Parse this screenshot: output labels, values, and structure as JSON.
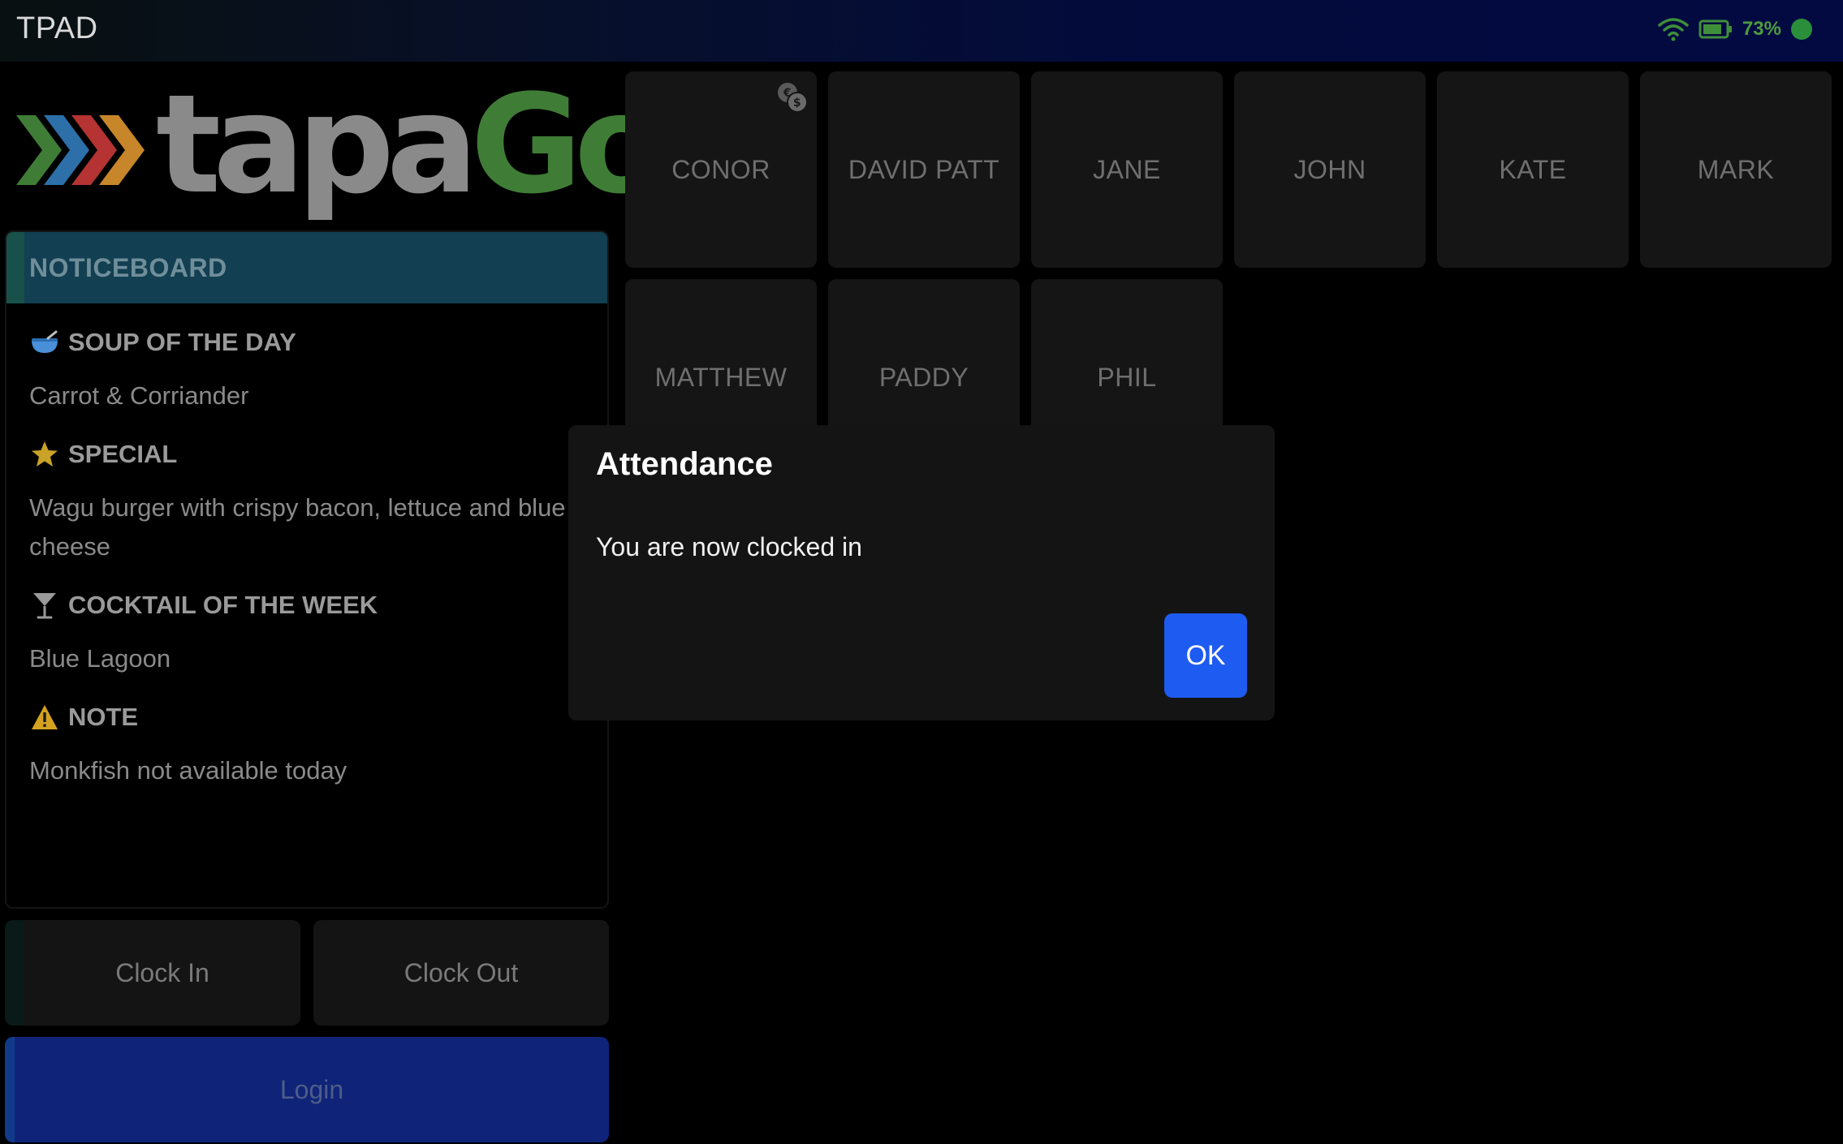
{
  "status_bar": {
    "device_name": "TPAD",
    "battery_percent": "73%",
    "icons": [
      "wifi-icon",
      "battery-icon",
      "status-dot"
    ]
  },
  "logo": {
    "text_part1": "tapa",
    "text_part2": "Go",
    "colors": {
      "tapa": "#8a8a8a",
      "go": "#3f7d36",
      "chevrons": [
        "#3f7d36",
        "#2d6fa8",
        "#b53333",
        "#c7862a"
      ]
    }
  },
  "noticeboard": {
    "header": "NOTICEBOARD",
    "items": [
      {
        "icon": "soup-bowl-icon",
        "title": "SOUP OF THE DAY",
        "text": "Carrot & Corriander"
      },
      {
        "icon": "star-icon",
        "title": "SPECIAL",
        "text": "Wagu burger with crispy bacon, lettuce and blue cheese"
      },
      {
        "icon": "cocktail-icon",
        "title": "COCKTAIL OF THE WEEK",
        "text": "Blue Lagoon"
      },
      {
        "icon": "warning-icon",
        "title": "NOTE",
        "text": "Monkfish not available today"
      }
    ]
  },
  "buttons": {
    "clock_in": "Clock In",
    "clock_out": "Clock Out",
    "login": "Login"
  },
  "staff": [
    "CONOR",
    "DAVID PATT",
    "JANE",
    "JOHN",
    "KATE",
    "MARK",
    "MATTHEW",
    "PADDY",
    "PHIL"
  ],
  "dialog": {
    "title": "Attendance",
    "message": "You are now clocked in",
    "ok_label": "OK",
    "accent_color": "#1e5bf0"
  }
}
